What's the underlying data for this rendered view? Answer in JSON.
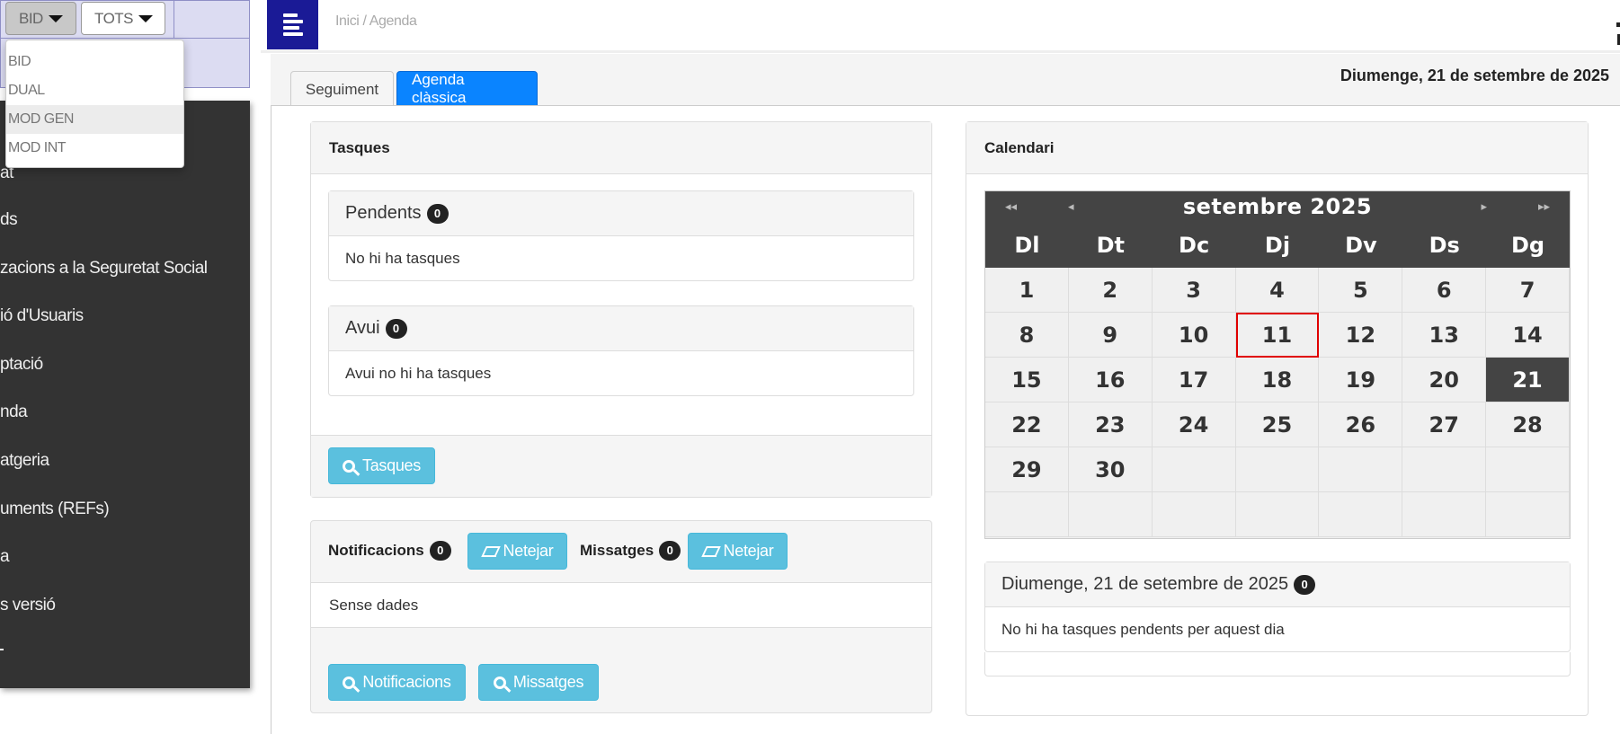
{
  "filters": {
    "selector1_label": "BID",
    "selector2_label": "TOTS",
    "dropdown_items": [
      "BID",
      "DUAL",
      "MOD GEN",
      "MOD INT"
    ]
  },
  "sidebar": {
    "items": [
      "at",
      "ds",
      "zacions a la Seguretat Social",
      "ió d'Usuaris",
      "ptació",
      "nda",
      "atgeria",
      "uments (REFs)",
      "a",
      "s versió"
    ]
  },
  "header": {
    "breadcrumb": "Inici / Agenda"
  },
  "tabs": [
    {
      "label": "Seguiment"
    },
    {
      "label": "Agenda clàssica"
    }
  ],
  "date_title": "Diumenge, 21 de setembre de 2025",
  "tasks_panel": {
    "title": "Tasques",
    "pending": {
      "title": "Pendents",
      "count": "0",
      "empty_text": "No hi ha tasques"
    },
    "today": {
      "title": "Avui",
      "count": "0",
      "empty_text": "Avui no hi ha tasques"
    },
    "button_label": "Tasques"
  },
  "notifications_panel": {
    "notifications_label": "Notificacions",
    "notifications_count": "0",
    "clear_label_1": "Netejar",
    "messages_label": "Missatges",
    "messages_count": "0",
    "clear_label_2": "Netejar",
    "empty_text": "Sense dades",
    "btn_notifications": "Notificacions",
    "btn_messages": "Missatges"
  },
  "calendar_panel": {
    "title": "Calendari",
    "month_label": "setembre 2025",
    "nav_prev_year": "◂◂",
    "nav_prev_month": "◂",
    "nav_next_month": "▸",
    "nav_next_year": "▸▸",
    "weekdays": [
      "Dl",
      "Dt",
      "Dc",
      "Dj",
      "Dv",
      "Ds",
      "Dg"
    ],
    "days": [
      "1",
      "2",
      "3",
      "4",
      "5",
      "6",
      "7",
      "8",
      "9",
      "10",
      "11",
      "12",
      "13",
      "14",
      "15",
      "16",
      "17",
      "18",
      "19",
      "20",
      "21",
      "22",
      "23",
      "24",
      "25",
      "26",
      "27",
      "28",
      "29",
      "30",
      "",
      "",
      "",
      "",
      "",
      "",
      "",
      "",
      "",
      "",
      "",
      ""
    ],
    "today": "21",
    "selected": "11"
  },
  "day_panel": {
    "title": "Diumenge, 21 de setembre de 2025",
    "count": "0",
    "empty_text": "No hi ha tasques pendents per aquest dia"
  },
  "colors": {
    "brand": "#1a1a96",
    "tab_active": "#0a84ff",
    "info_button": "#5bc0de",
    "calendar_header": "#444444",
    "selected_outline": "#e00000"
  }
}
